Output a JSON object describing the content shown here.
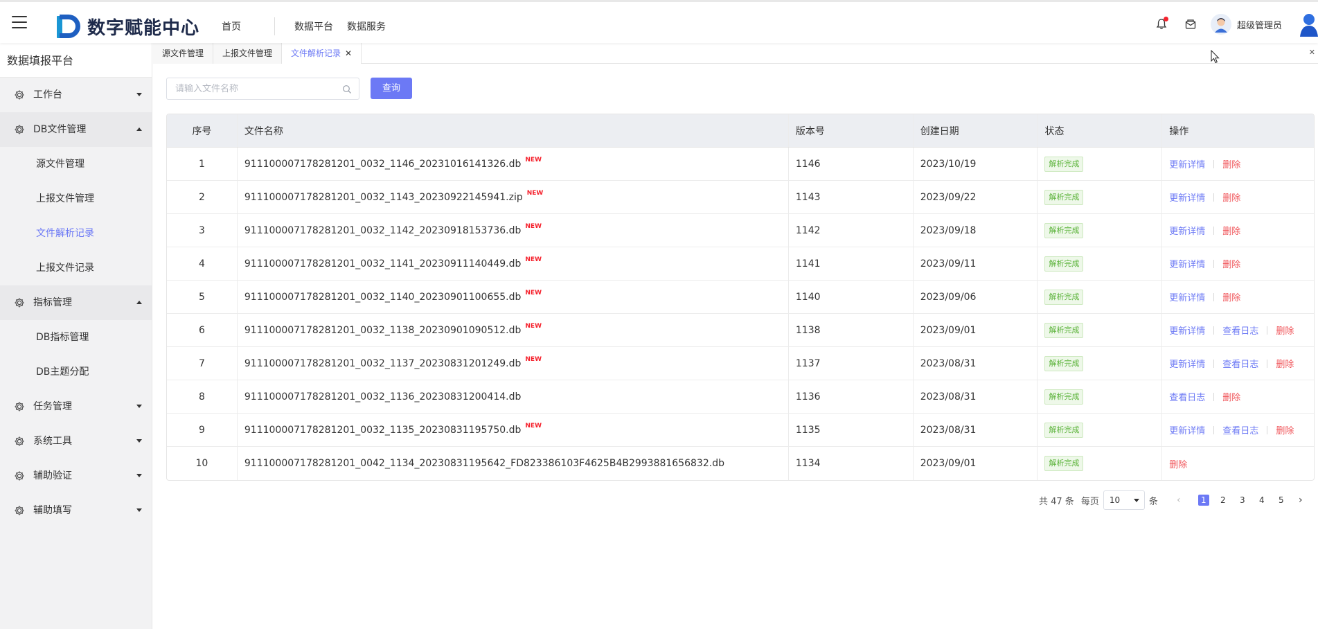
{
  "header": {
    "logo_text": "数字赋能中心",
    "nav": [
      "首页",
      "数据平台",
      "数据服务"
    ],
    "username": "超级管理员",
    "icons": [
      "menu-icon",
      "bell-icon",
      "mail-icon",
      "avatar",
      "user-icon"
    ],
    "accent": "#6c79f5"
  },
  "sidebar": {
    "title": "数据填报平台",
    "menu": [
      {
        "label": "工作台",
        "icon": "gear-icon",
        "expanded": false,
        "children": []
      },
      {
        "label": "DB文件管理",
        "icon": "gear-icon",
        "expanded": true,
        "children": [
          {
            "label": "源文件管理",
            "active": false
          },
          {
            "label": "上报文件管理",
            "active": false
          },
          {
            "label": "文件解析记录",
            "active": true
          },
          {
            "label": "上报文件记录",
            "active": false
          }
        ]
      },
      {
        "label": "指标管理",
        "icon": "gear-icon",
        "expanded": true,
        "children": [
          {
            "label": "DB指标管理",
            "active": false
          },
          {
            "label": "DB主题分配",
            "active": false
          }
        ]
      },
      {
        "label": "任务管理",
        "icon": "gear-icon",
        "expanded": false,
        "children": []
      },
      {
        "label": "系统工具",
        "icon": "gear-icon",
        "expanded": false,
        "children": []
      },
      {
        "label": "辅助验证",
        "icon": "gear-icon",
        "expanded": false,
        "children": []
      },
      {
        "label": "辅助填写",
        "icon": "gear-icon",
        "expanded": false,
        "children": []
      }
    ]
  },
  "tabs": [
    {
      "label": "源文件管理",
      "active": false,
      "closable": false
    },
    {
      "label": "上报文件管理",
      "active": false,
      "closable": false
    },
    {
      "label": "文件解析记录",
      "active": true,
      "closable": true
    }
  ],
  "search": {
    "placeholder": "请输入文件名称",
    "value": "",
    "button_label": "查询"
  },
  "table": {
    "columns": [
      "序号",
      "文件名称",
      "版本号",
      "创建日期",
      "状态",
      "操作"
    ],
    "new_badge": "NEW",
    "rows": [
      {
        "idx": "1",
        "name": "911100007178281201_0032_1146_20231016141326.db",
        "new": true,
        "version": "1146",
        "date": "2023/10/19",
        "status": "解析完成",
        "ops": [
          "更新详情",
          "删除"
        ]
      },
      {
        "idx": "2",
        "name": "911100007178281201_0032_1143_20230922145941.zip",
        "new": true,
        "version": "1143",
        "date": "2023/09/22",
        "status": "解析完成",
        "ops": [
          "更新详情",
          "删除"
        ]
      },
      {
        "idx": "3",
        "name": "911100007178281201_0032_1142_20230918153736.db",
        "new": true,
        "version": "1142",
        "date": "2023/09/18",
        "status": "解析完成",
        "ops": [
          "更新详情",
          "删除"
        ]
      },
      {
        "idx": "4",
        "name": "911100007178281201_0032_1141_20230911140449.db",
        "new": true,
        "version": "1141",
        "date": "2023/09/11",
        "status": "解析完成",
        "ops": [
          "更新详情",
          "删除"
        ]
      },
      {
        "idx": "5",
        "name": "911100007178281201_0032_1140_20230901100655.db",
        "new": true,
        "version": "1140",
        "date": "2023/09/06",
        "status": "解析完成",
        "ops": [
          "更新详情",
          "删除"
        ]
      },
      {
        "idx": "6",
        "name": "911100007178281201_0032_1138_20230901090512.db",
        "new": true,
        "version": "1138",
        "date": "2023/09/01",
        "status": "解析完成",
        "ops": [
          "更新详情",
          "查看日志",
          "删除"
        ]
      },
      {
        "idx": "7",
        "name": "911100007178281201_0032_1137_20230831201249.db",
        "new": true,
        "version": "1137",
        "date": "2023/08/31",
        "status": "解析完成",
        "ops": [
          "更新详情",
          "查看日志",
          "删除"
        ]
      },
      {
        "idx": "8",
        "name": "911100007178281201_0032_1136_20230831200414.db",
        "new": false,
        "version": "1136",
        "date": "2023/08/31",
        "status": "解析完成",
        "ops": [
          "查看日志",
          "删除"
        ]
      },
      {
        "idx": "9",
        "name": "911100007178281201_0032_1135_20230831195750.db",
        "new": true,
        "version": "1135",
        "date": "2023/08/31",
        "status": "解析完成",
        "ops": [
          "更新详情",
          "查看日志",
          "删除"
        ]
      },
      {
        "idx": "10",
        "name": "911100007178281201_0042_1134_20230831195642_FD823386103F4625B4B2993881656832.db",
        "new": false,
        "version": "1134",
        "date": "2023/09/01",
        "status": "解析完成",
        "ops": [
          "删除"
        ]
      }
    ]
  },
  "pagination": {
    "total_label": "共 47 条",
    "per_page_label": "每页",
    "page_size": "10",
    "unit_label": "条",
    "pages": [
      "1",
      "2",
      "3",
      "4",
      "5"
    ],
    "current": "1",
    "prev_symbol": "‹",
    "next_symbol": "›"
  }
}
